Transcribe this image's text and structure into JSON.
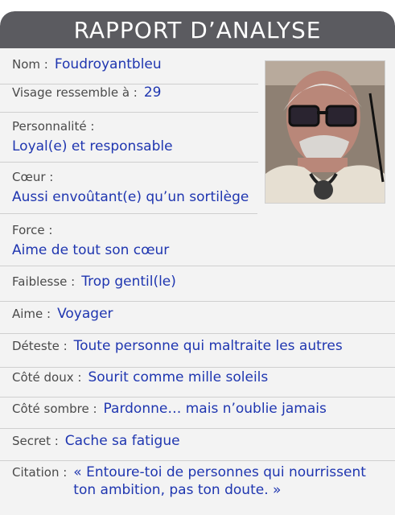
{
  "title": "RAPPORT D’ANALYSE",
  "fields": [
    {
      "label": "Nom :",
      "value": "Foudroyantbleu"
    },
    {
      "label": "Visage ressemble à :",
      "value": "29"
    },
    {
      "label": "Personnalité :",
      "value": "Loyal(e) et responsable"
    },
    {
      "label": "Cœur :",
      "value": "Aussi envoûtant(e) qu’un sortilège"
    },
    {
      "label": "Force :",
      "value": "Aime de tout son cœur"
    },
    {
      "label": "Faiblesse :",
      "value": "Trop gentil(le)"
    },
    {
      "label": "Aime :",
      "value": "Voyager"
    },
    {
      "label": "Déteste :",
      "value": "Toute personne qui maltraite les autres"
    },
    {
      "label": "Côté doux :",
      "value": "Sourit comme mille soleils"
    },
    {
      "label": "Côté sombre :",
      "value": "Pardonne… mais n’oublie jamais"
    },
    {
      "label": "Secret :",
      "value": "Cache sa fatigue"
    },
    {
      "label": "Citation :",
      "value": "« Entoure-toi de personnes qui nourrissent ton ambition, pas ton doute. »"
    }
  ],
  "colors": {
    "header": "#5b5b60",
    "value_text": "#1f36b0",
    "label_text": "#4a4a4a"
  }
}
